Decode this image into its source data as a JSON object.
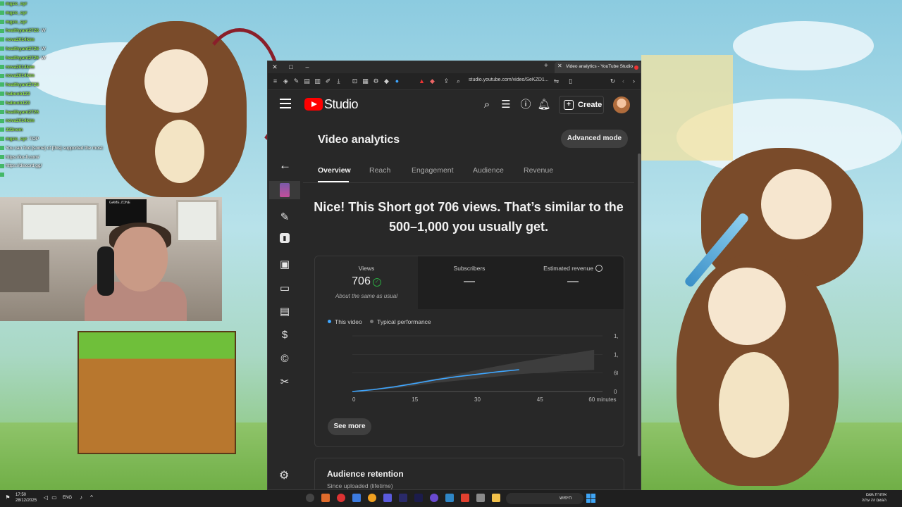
{
  "chat": [
    {
      "user": "mgzo_syr",
      "msg": ""
    },
    {
      "user": "mgzo_syr",
      "msg": ""
    },
    {
      "user": "mgzo_syr",
      "msg": ""
    },
    {
      "user": "healthyant2726",
      "msg": ": W"
    },
    {
      "user": "nova2014kim",
      "msg": ""
    },
    {
      "user": "healthyant2726",
      "msg": ": W"
    },
    {
      "user": "healthyant2726",
      "msg": ": W"
    },
    {
      "user": "nova2014kim",
      "msg": ""
    },
    {
      "user": "nova2014kim",
      "msg": ""
    },
    {
      "user": "healthyant2726",
      "msg": ""
    },
    {
      "user": "haboob123",
      "msg": ""
    },
    {
      "user": "haboob123",
      "msg": ""
    },
    {
      "user": "healthyant2726",
      "msg": ""
    },
    {
      "user": "nova2014kim",
      "msg": ""
    },
    {
      "user": "333nem",
      "msg": ""
    },
    {
      "user": "mgzo_syr",
      "msg": ": TOP"
    },
    {
      "user": "",
      "msg": "You can find [some] of [this] supported the most:"
    },
    {
      "user": "",
      "msg": "https://ko-fi.com/"
    },
    {
      "user": "",
      "msg": "https://discord.gg/"
    },
    {
      "user": "",
      "msg": ""
    }
  ],
  "webcam": {
    "tv_text": "GAME ZONE"
  },
  "browser": {
    "tab_title": "Video analytics - YouTube Studio",
    "url": "studio.youtube.com/video/SeKZD1..."
  },
  "studio": {
    "logo_text": "Studio",
    "create_label": "Create",
    "page_title": "Video analytics",
    "advanced_mode_label": "Advanced mode",
    "tabs": [
      "Overview",
      "Reach",
      "Engagement",
      "Audience",
      "Revenue"
    ],
    "headline": "Nice! This Short got 706 views. That’s similar to the 500–1,000 you usually get.",
    "metrics": [
      {
        "label": "Views",
        "value": "706",
        "sub": "About the same as usual"
      },
      {
        "label": "Subscribers",
        "value": "—",
        "sub": ""
      },
      {
        "label": "Estimated revenue",
        "value": "—",
        "sub": ""
      }
    ],
    "legend": {
      "this_video": "This video",
      "typical": "Typical performance"
    },
    "see_more_label": "See more",
    "retention_title": "Audience retention",
    "retention_sub": "Since uploaded (lifetime)"
  },
  "colors": {
    "this_video": "#3ea6ff",
    "typical_band": "#3d3d3d",
    "accent_red": "#ff0000"
  },
  "chart_data": {
    "type": "line",
    "title": "",
    "xlabel": "",
    "ylabel": "",
    "x_ticks": [
      "0",
      "15",
      "30",
      "45",
      "60 minutes"
    ],
    "y_ticks": [
      "0",
      "600",
      "1,200",
      "1,800"
    ],
    "xlim": [
      0,
      60
    ],
    "ylim": [
      0,
      1800
    ],
    "series": [
      {
        "name": "This video",
        "x": [
          0,
          5,
          10,
          15,
          20,
          25,
          30,
          35,
          40
        ],
        "values": [
          0,
          60,
          150,
          260,
          380,
          480,
          560,
          640,
          706
        ]
      },
      {
        "name": "Typical performance",
        "x": [
          0,
          10,
          20,
          30,
          40,
          50,
          58
        ],
        "low": [
          0,
          100,
          280,
          420,
          560,
          650,
          700
        ],
        "high": [
          0,
          180,
          420,
          700,
          950,
          1180,
          1350
        ]
      }
    ]
  },
  "taskbar": {
    "time": "17:50",
    "date": "28/12/2025",
    "lang": "ENG",
    "search_text": "חיפוש",
    "weather_line1": "אזהרת גשם",
    "weather_line2": "הגשם זה עתה"
  }
}
